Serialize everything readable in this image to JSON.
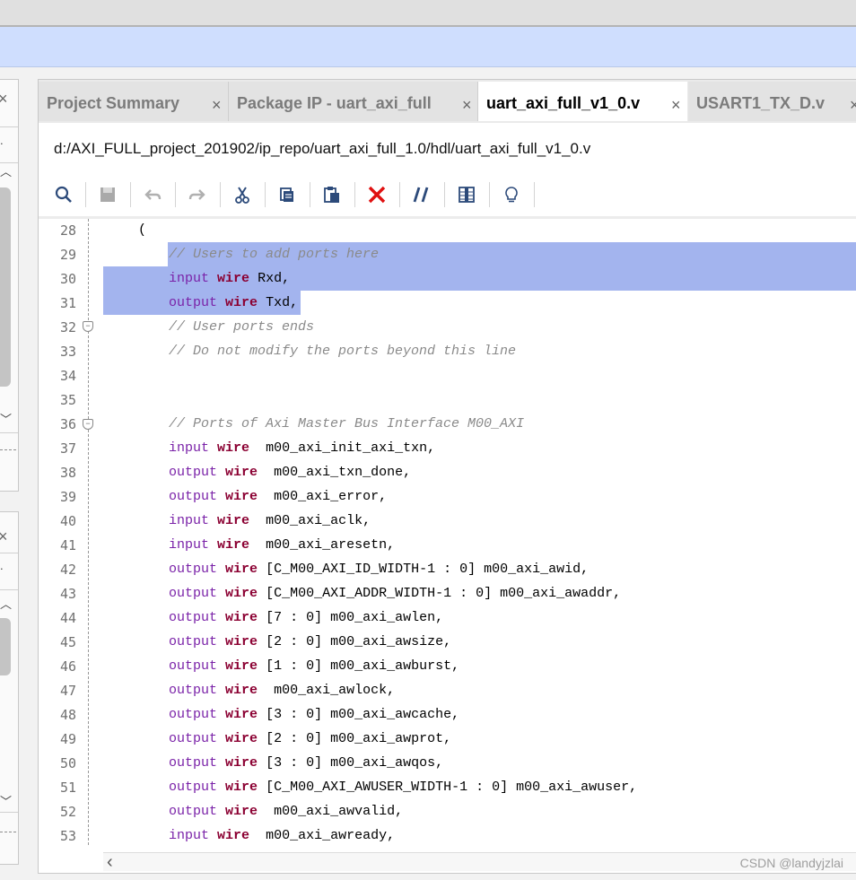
{
  "tabs": [
    {
      "label": "Project Summary",
      "active": false
    },
    {
      "label": "Package IP - uart_axi_full",
      "active": false
    },
    {
      "label": "uart_axi_full_v1_0.v",
      "active": true
    },
    {
      "label": "USART1_TX_D.v",
      "active": false
    }
  ],
  "file_path": "d:/AXI_FULL_project_201902/ip_repo/uart_axi_full_1.0/hdl/uart_axi_full_v1_0.v",
  "toolbar_icons": [
    "search-icon",
    "save-icon",
    "undo-icon",
    "redo-icon",
    "cut-icon",
    "copy-icon",
    "paste-icon",
    "delete-icon",
    "comment-icon",
    "column-icon",
    "hint-icon"
  ],
  "colors": {
    "selection": "#a3b4ee",
    "keyword_type": "#7a22a8",
    "keyword_wire": "#8b0032",
    "comment": "#8a8a8a",
    "delete_icon": "#e01010",
    "blue_bar": "#cfdefe"
  },
  "code": {
    "l28": {
      "num": "28",
      "text": "("
    },
    "l29": {
      "num": "29",
      "comment": "// Users to add ports here"
    },
    "l30": {
      "num": "30",
      "kw": "input",
      "wire": "wire",
      "rest": "Rxd,"
    },
    "l31": {
      "num": "31",
      "kw": "output",
      "wire": "wire",
      "rest": "Txd,"
    },
    "l32": {
      "num": "32",
      "comment": "// User ports ends"
    },
    "l33": {
      "num": "33",
      "comment": "// Do not modify the ports beyond this line"
    },
    "l34": {
      "num": "34"
    },
    "l35": {
      "num": "35"
    },
    "l36": {
      "num": "36",
      "comment": "// Ports of Axi Master Bus Interface M00_AXI"
    },
    "l37": {
      "num": "37",
      "kw": "input",
      "wire": "wire",
      "rest": " m00_axi_init_axi_txn,"
    },
    "l38": {
      "num": "38",
      "kw": "output",
      "wire": "wire",
      "rest": " m00_axi_txn_done,"
    },
    "l39": {
      "num": "39",
      "kw": "output",
      "wire": "wire",
      "rest": " m00_axi_error,"
    },
    "l40": {
      "num": "40",
      "kw": "input",
      "wire": "wire",
      "rest": " m00_axi_aclk,"
    },
    "l41": {
      "num": "41",
      "kw": "input",
      "wire": "wire",
      "rest": " m00_axi_aresetn,"
    },
    "l42": {
      "num": "42",
      "kw": "output",
      "wire": "wire",
      "rest": "[C_M00_AXI_ID_WIDTH-1 : 0] m00_axi_awid,"
    },
    "l43": {
      "num": "43",
      "kw": "output",
      "wire": "wire",
      "rest": "[C_M00_AXI_ADDR_WIDTH-1 : 0] m00_axi_awaddr,"
    },
    "l44": {
      "num": "44",
      "kw": "output",
      "wire": "wire",
      "rest": "[7 : 0] m00_axi_awlen,"
    },
    "l45": {
      "num": "45",
      "kw": "output",
      "wire": "wire",
      "rest": "[2 : 0] m00_axi_awsize,"
    },
    "l46": {
      "num": "46",
      "kw": "output",
      "wire": "wire",
      "rest": "[1 : 0] m00_axi_awburst,"
    },
    "l47": {
      "num": "47",
      "kw": "output",
      "wire": "wire",
      "rest": " m00_axi_awlock,"
    },
    "l48": {
      "num": "48",
      "kw": "output",
      "wire": "wire",
      "rest": "[3 : 0] m00_axi_awcache,"
    },
    "l49": {
      "num": "49",
      "kw": "output",
      "wire": "wire",
      "rest": "[2 : 0] m00_axi_awprot,"
    },
    "l50": {
      "num": "50",
      "kw": "output",
      "wire": "wire",
      "rest": "[3 : 0] m00_axi_awqos,"
    },
    "l51": {
      "num": "51",
      "kw": "output",
      "wire": "wire",
      "rest": "[C_M00_AXI_AWUSER_WIDTH-1 : 0] m00_axi_awuser,"
    },
    "l52": {
      "num": "52",
      "kw": "output",
      "wire": "wire",
      "rest": " m00_axi_awvalid,"
    },
    "l53": {
      "num": "53",
      "kw": "input",
      "wire": "wire",
      "rest": " m00_axi_awready,"
    }
  },
  "watermark": "CSDN @landyjzlai"
}
